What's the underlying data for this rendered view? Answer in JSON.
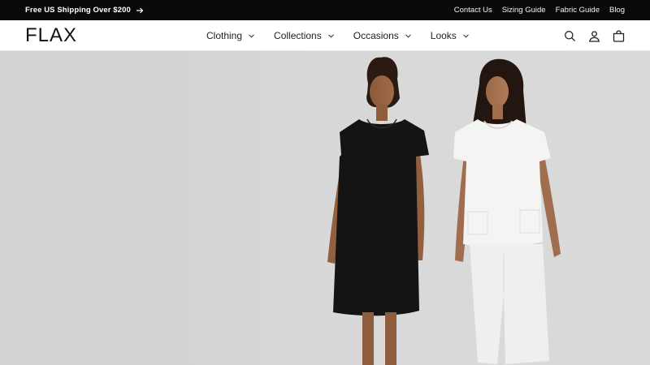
{
  "announcement": {
    "text": "Free US Shipping Over $200",
    "icon": "arrow-right-icon"
  },
  "utility_links": [
    "Contact Us",
    "Sizing Guide",
    "Fabric Guide",
    "Blog"
  ],
  "brand": {
    "logo": "FLAX"
  },
  "nav": [
    "Clothing",
    "Collections",
    "Occasions",
    "Looks"
  ],
  "header_icons": [
    "search-icon",
    "account-icon",
    "cart-icon"
  ],
  "colors": {
    "announcement_bg": "#0a0a0a",
    "hero_bg": "#d4d4d4"
  }
}
